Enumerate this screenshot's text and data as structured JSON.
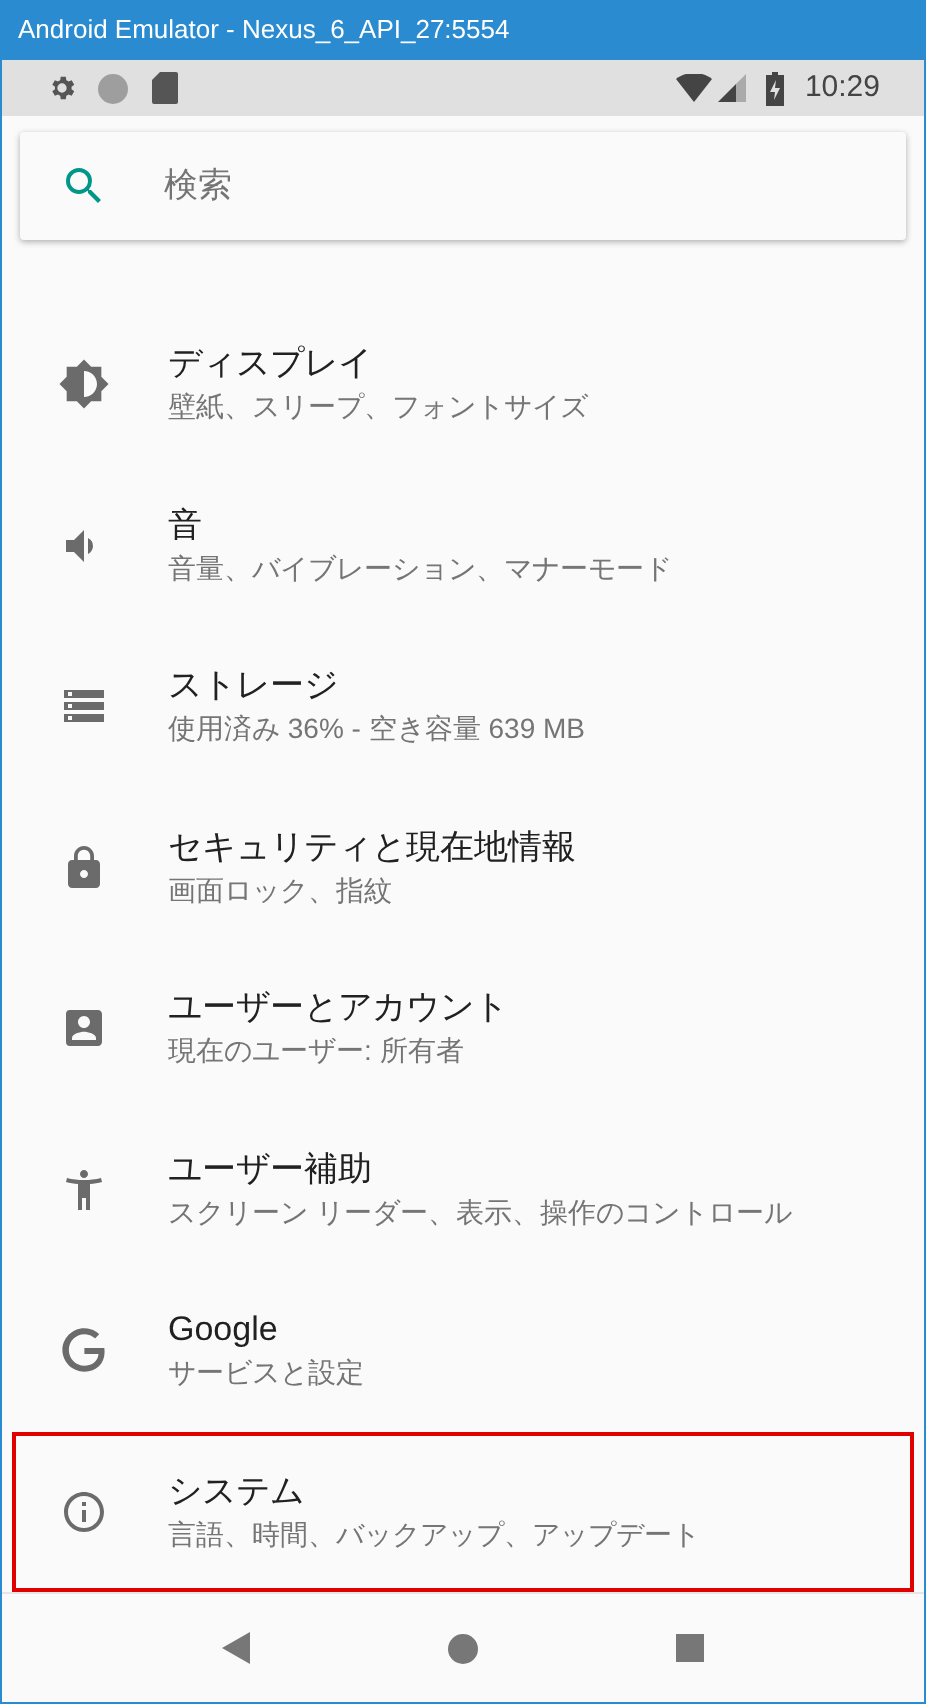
{
  "window": {
    "title": "Android Emulator - Nexus_6_API_27:5554"
  },
  "status_bar": {
    "time": "10:29"
  },
  "search": {
    "placeholder": "検索"
  },
  "items": [
    {
      "kind": "display",
      "title": "ディスプレイ",
      "subtitle": "壁紙、スリープ、フォントサイズ",
      "highlighted": false
    },
    {
      "kind": "sound",
      "title": "音",
      "subtitle": "音量、バイブレーション、マナーモード",
      "highlighted": false
    },
    {
      "kind": "storage",
      "title": "ストレージ",
      "subtitle": "使用済み 36% - 空き容量 639 MB",
      "highlighted": false
    },
    {
      "kind": "lock",
      "title": "セキュリティと現在地情報",
      "subtitle": "画面ロック、指紋",
      "highlighted": false
    },
    {
      "kind": "account",
      "title": "ユーザーとアカウント",
      "subtitle": "現在のユーザー: 所有者",
      "highlighted": false
    },
    {
      "kind": "accessibility",
      "title": "ユーザー補助",
      "subtitle": "スクリーン リーダー、表示、操作のコントロール",
      "highlighted": false
    },
    {
      "kind": "google",
      "title": "Google",
      "subtitle": "サービスと設定",
      "highlighted": false
    },
    {
      "kind": "info",
      "title": "システム",
      "subtitle": "言語、時間、バックアップ、アップデート",
      "highlighted": true
    }
  ]
}
